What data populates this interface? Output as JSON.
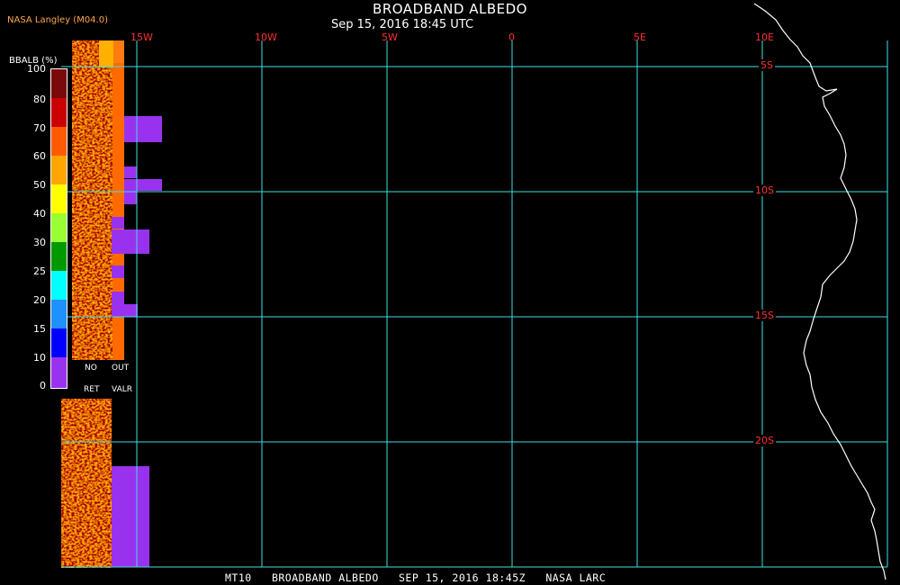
{
  "map": {
    "title": "BROADBAND ALBEDO",
    "subtitle": "Sep 15, 2016 18:45 UTC",
    "credit": "NASA Langley (M04.0)",
    "footer": "MT10   BROADBAND ALBEDO   SEP 15, 2016 18:45Z   NASA LARC",
    "lon_labels": [
      "15W",
      "10W",
      "5W",
      "0",
      "5E",
      "10E"
    ],
    "lat_labels": [
      "5S",
      "10S",
      "15S",
      "20S"
    ],
    "colors": {
      "background": "#000000",
      "grid": "#40e0e0",
      "coast": "#ffffff",
      "labels": "#ff3030",
      "purple": "#9932ee"
    }
  },
  "colorbar": {
    "title": "BBALB (%)",
    "ticks": [
      "100",
      "80",
      "70",
      "60",
      "50",
      "40",
      "30",
      "25",
      "20",
      "15",
      "10",
      "0"
    ],
    "colors": [
      "#7a0a0a",
      "#cc0000",
      "#ff0000",
      "#ff5a00",
      "#ffa500",
      "#ffff00",
      "#99ff33",
      "#33cc33",
      "#007a00",
      "#00ffff",
      "#1e90ff",
      "#0000ff",
      "#0000aa",
      "#9932ee"
    ],
    "legend": {
      "no": "NO",
      "ret": "RET",
      "out": "OUT",
      "valr": "VALR"
    }
  }
}
